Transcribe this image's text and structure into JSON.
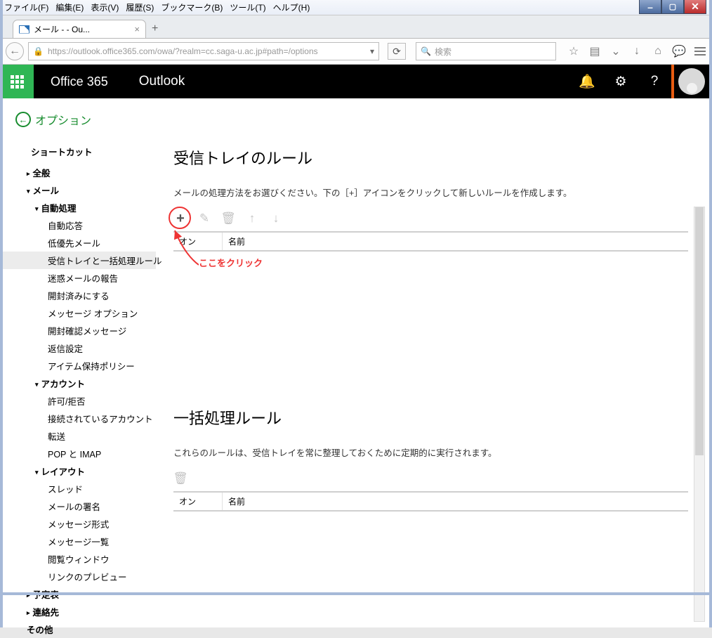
{
  "menubar": [
    "ファイル(F)",
    "編集(E)",
    "表示(V)",
    "履歴(S)",
    "ブックマーク(B)",
    "ツール(T)",
    "ヘルプ(H)"
  ],
  "browser": {
    "tab_title": "メール -              - Ou...",
    "url": "https://outlook.office365.com/owa/?realm=cc.saga-u.ac.jp#path=/options",
    "search_placeholder": "検索"
  },
  "o365": {
    "brand": "Office 365",
    "app": "Outlook"
  },
  "options": {
    "title": "オプション"
  },
  "sidebar": {
    "heading": "ショートカット",
    "top": [
      {
        "label": "全般",
        "caret": true,
        "open": false,
        "lev": 0
      },
      {
        "label": "メール",
        "caret": true,
        "open": true,
        "lev": 0
      },
      {
        "label": "自動処理",
        "caret": true,
        "open": true,
        "lev": 1
      },
      {
        "label": "自動応答",
        "lev": 2
      },
      {
        "label": "低優先メール",
        "lev": 2
      },
      {
        "label": "受信トレイと一括処理ルール",
        "lev": 2,
        "active": true
      },
      {
        "label": "迷惑メールの報告",
        "lev": 2
      },
      {
        "label": "開封済みにする",
        "lev": 2
      },
      {
        "label": "メッセージ オプション",
        "lev": 2
      },
      {
        "label": "開封確認メッセージ",
        "lev": 2
      },
      {
        "label": "返信設定",
        "lev": 2
      },
      {
        "label": "アイテム保持ポリシー",
        "lev": 2
      },
      {
        "label": "アカウント",
        "caret": true,
        "open": true,
        "lev": 1
      },
      {
        "label": "許可/拒否",
        "lev": 2
      },
      {
        "label": "接続されているアカウント",
        "lev": 2
      },
      {
        "label": "転送",
        "lev": 2
      },
      {
        "label": "POP と IMAP",
        "lev": 2
      },
      {
        "label": "レイアウト",
        "caret": true,
        "open": true,
        "lev": 1
      },
      {
        "label": "スレッド",
        "lev": 2
      },
      {
        "label": "メールの署名",
        "lev": 2
      },
      {
        "label": "メッセージ形式",
        "lev": 2
      },
      {
        "label": "メッセージ一覧",
        "lev": 2
      },
      {
        "label": "閲覧ウィンドウ",
        "lev": 2
      },
      {
        "label": "リンクのプレビュー",
        "lev": 2
      },
      {
        "label": "予定表",
        "caret": true,
        "open": false,
        "lev": 0
      },
      {
        "label": "連絡先",
        "caret": true,
        "open": false,
        "lev": 0
      },
      {
        "label": "その他",
        "lev": 0,
        "caret": false
      }
    ]
  },
  "main": {
    "inbox_rules_title": "受信トレイのルール",
    "inbox_rules_explain": "メールの処理方法をお選びください。下の［+］アイコンをクリックして新しいルールを作成します。",
    "sweep_rules_title": "一括処理ルール",
    "sweep_rules_explain": "これらのルールは、受信トレイを常に整理しておくために定期的に実行されます。",
    "col_on": "オン",
    "col_name": "名前"
  },
  "annotation": {
    "text": "ここをクリック"
  }
}
